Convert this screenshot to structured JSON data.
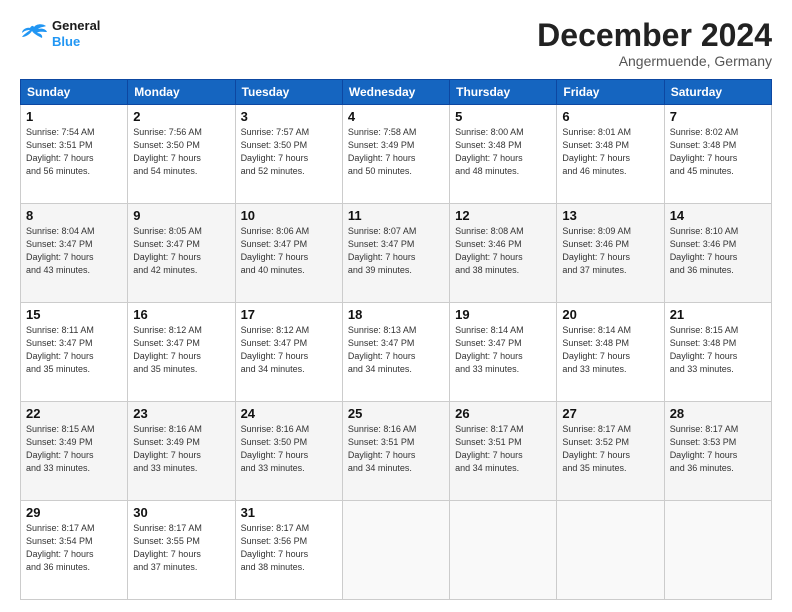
{
  "header": {
    "logo_line1": "General",
    "logo_line2": "Blue",
    "month": "December 2024",
    "location": "Angermuende, Germany"
  },
  "days_of_week": [
    "Sunday",
    "Monday",
    "Tuesday",
    "Wednesday",
    "Thursday",
    "Friday",
    "Saturday"
  ],
  "weeks": [
    [
      {
        "num": "1",
        "sunrise": "7:54 AM",
        "sunset": "3:51 PM",
        "daylight": "7 hours and 56 minutes."
      },
      {
        "num": "2",
        "sunrise": "7:56 AM",
        "sunset": "3:50 PM",
        "daylight": "7 hours and 54 minutes."
      },
      {
        "num": "3",
        "sunrise": "7:57 AM",
        "sunset": "3:50 PM",
        "daylight": "7 hours and 52 minutes."
      },
      {
        "num": "4",
        "sunrise": "7:58 AM",
        "sunset": "3:49 PM",
        "daylight": "7 hours and 50 minutes."
      },
      {
        "num": "5",
        "sunrise": "8:00 AM",
        "sunset": "3:48 PM",
        "daylight": "7 hours and 48 minutes."
      },
      {
        "num": "6",
        "sunrise": "8:01 AM",
        "sunset": "3:48 PM",
        "daylight": "7 hours and 46 minutes."
      },
      {
        "num": "7",
        "sunrise": "8:02 AM",
        "sunset": "3:48 PM",
        "daylight": "7 hours and 45 minutes."
      }
    ],
    [
      {
        "num": "8",
        "sunrise": "8:04 AM",
        "sunset": "3:47 PM",
        "daylight": "7 hours and 43 minutes."
      },
      {
        "num": "9",
        "sunrise": "8:05 AM",
        "sunset": "3:47 PM",
        "daylight": "7 hours and 42 minutes."
      },
      {
        "num": "10",
        "sunrise": "8:06 AM",
        "sunset": "3:47 PM",
        "daylight": "7 hours and 40 minutes."
      },
      {
        "num": "11",
        "sunrise": "8:07 AM",
        "sunset": "3:47 PM",
        "daylight": "7 hours and 39 minutes."
      },
      {
        "num": "12",
        "sunrise": "8:08 AM",
        "sunset": "3:46 PM",
        "daylight": "7 hours and 38 minutes."
      },
      {
        "num": "13",
        "sunrise": "8:09 AM",
        "sunset": "3:46 PM",
        "daylight": "7 hours and 37 minutes."
      },
      {
        "num": "14",
        "sunrise": "8:10 AM",
        "sunset": "3:46 PM",
        "daylight": "7 hours and 36 minutes."
      }
    ],
    [
      {
        "num": "15",
        "sunrise": "8:11 AM",
        "sunset": "3:47 PM",
        "daylight": "7 hours and 35 minutes."
      },
      {
        "num": "16",
        "sunrise": "8:12 AM",
        "sunset": "3:47 PM",
        "daylight": "7 hours and 35 minutes."
      },
      {
        "num": "17",
        "sunrise": "8:12 AM",
        "sunset": "3:47 PM",
        "daylight": "7 hours and 34 minutes."
      },
      {
        "num": "18",
        "sunrise": "8:13 AM",
        "sunset": "3:47 PM",
        "daylight": "7 hours and 34 minutes."
      },
      {
        "num": "19",
        "sunrise": "8:14 AM",
        "sunset": "3:47 PM",
        "daylight": "7 hours and 33 minutes."
      },
      {
        "num": "20",
        "sunrise": "8:14 AM",
        "sunset": "3:48 PM",
        "daylight": "7 hours and 33 minutes."
      },
      {
        "num": "21",
        "sunrise": "8:15 AM",
        "sunset": "3:48 PM",
        "daylight": "7 hours and 33 minutes."
      }
    ],
    [
      {
        "num": "22",
        "sunrise": "8:15 AM",
        "sunset": "3:49 PM",
        "daylight": "7 hours and 33 minutes."
      },
      {
        "num": "23",
        "sunrise": "8:16 AM",
        "sunset": "3:49 PM",
        "daylight": "7 hours and 33 minutes."
      },
      {
        "num": "24",
        "sunrise": "8:16 AM",
        "sunset": "3:50 PM",
        "daylight": "7 hours and 33 minutes."
      },
      {
        "num": "25",
        "sunrise": "8:16 AM",
        "sunset": "3:51 PM",
        "daylight": "7 hours and 34 minutes."
      },
      {
        "num": "26",
        "sunrise": "8:17 AM",
        "sunset": "3:51 PM",
        "daylight": "7 hours and 34 minutes."
      },
      {
        "num": "27",
        "sunrise": "8:17 AM",
        "sunset": "3:52 PM",
        "daylight": "7 hours and 35 minutes."
      },
      {
        "num": "28",
        "sunrise": "8:17 AM",
        "sunset": "3:53 PM",
        "daylight": "7 hours and 36 minutes."
      }
    ],
    [
      {
        "num": "29",
        "sunrise": "8:17 AM",
        "sunset": "3:54 PM",
        "daylight": "7 hours and 36 minutes."
      },
      {
        "num": "30",
        "sunrise": "8:17 AM",
        "sunset": "3:55 PM",
        "daylight": "7 hours and 37 minutes."
      },
      {
        "num": "31",
        "sunrise": "8:17 AM",
        "sunset": "3:56 PM",
        "daylight": "7 hours and 38 minutes."
      },
      null,
      null,
      null,
      null
    ]
  ]
}
